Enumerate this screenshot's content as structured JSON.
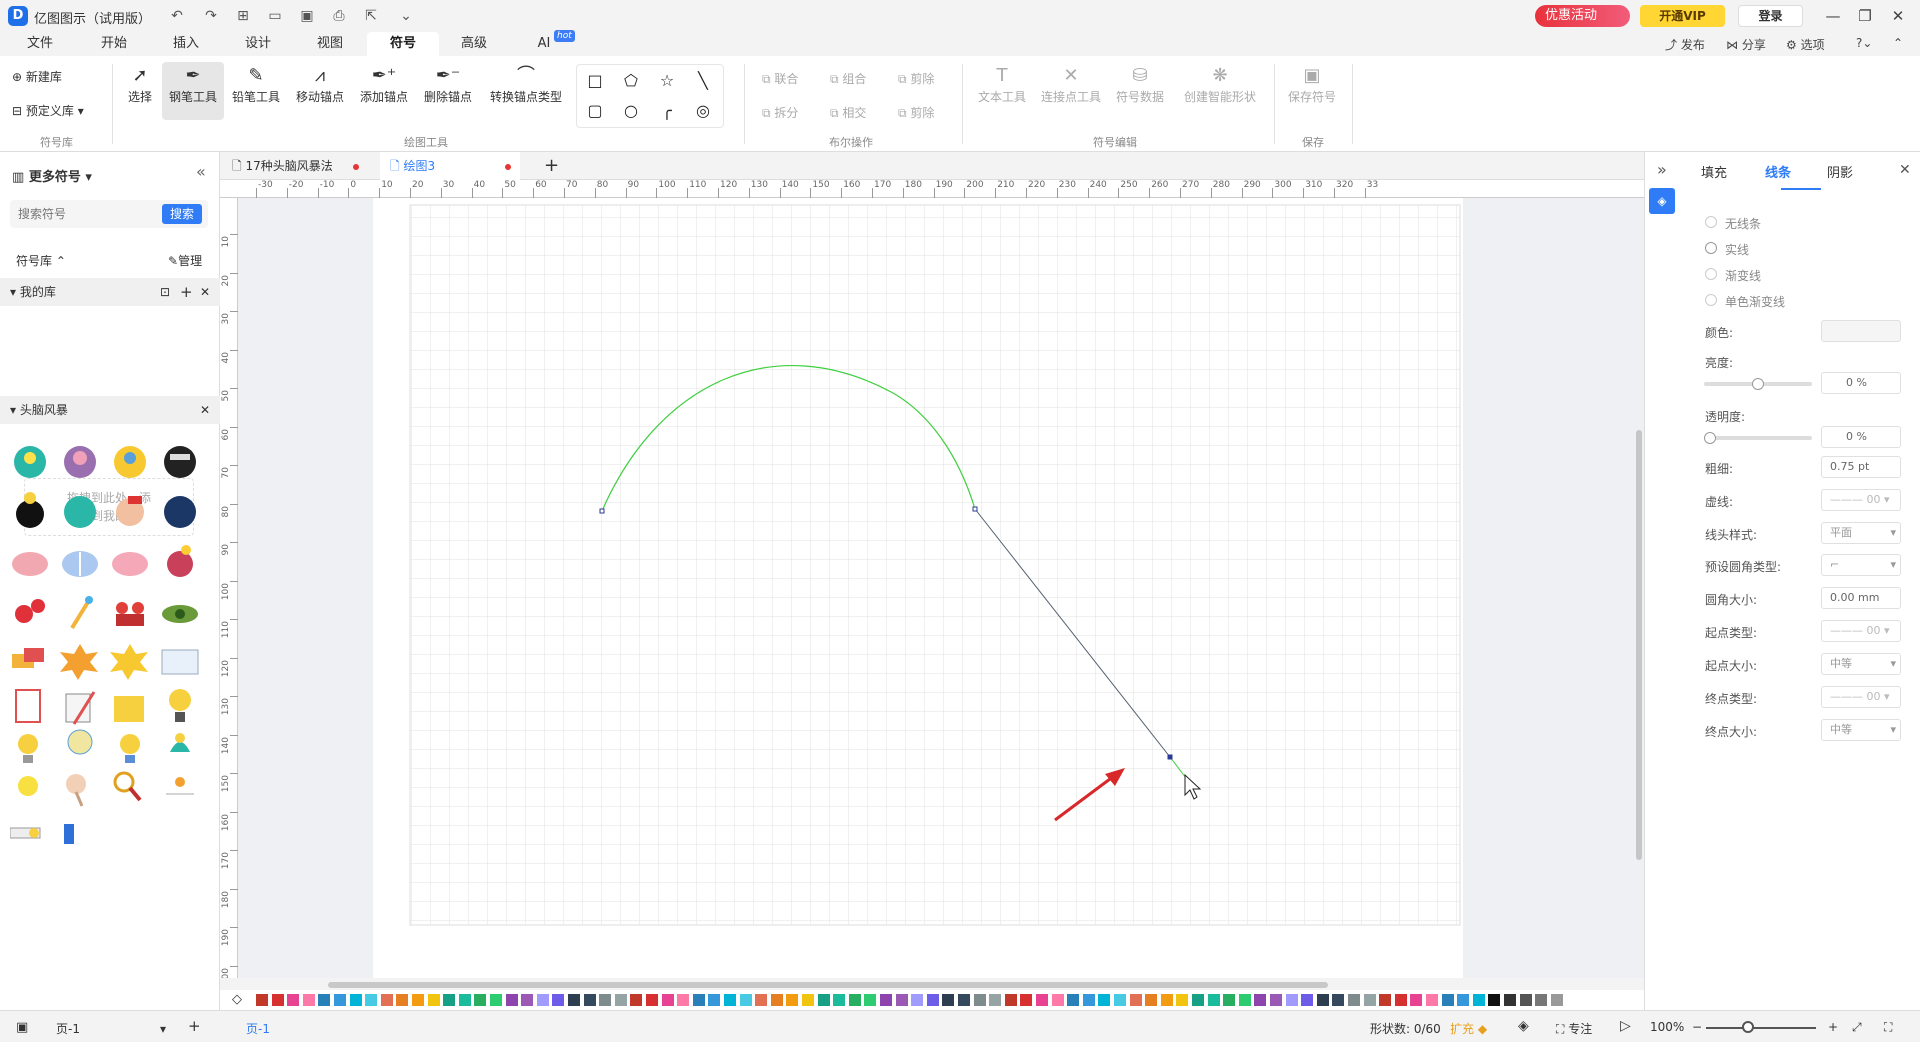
{
  "app": {
    "logo": "D",
    "title": "亿图图示（试用版）",
    "promo": "优惠活动",
    "vip": "开通VIP",
    "login": "登录"
  },
  "quick_access": [
    "undo-icon",
    "redo-icon",
    "new-icon",
    "open-icon",
    "save-icon",
    "print-icon",
    "export-icon",
    "more-icon"
  ],
  "menu": {
    "items": [
      "文件",
      "开始",
      "插入",
      "设计",
      "视图",
      "符号",
      "高级",
      "AI"
    ],
    "active": "符号",
    "hot_badge": "hot",
    "right": {
      "publish": "发布",
      "share": "分享",
      "options": "选项"
    }
  },
  "ribbon": {
    "library": {
      "new_lib": "新建库",
      "predefined": "预定义库",
      "group": "符号库"
    },
    "draw_tools": {
      "select": "选择",
      "pen": "钢笔工具",
      "pencil": "铅笔工具",
      "move_anchor": "移动锚点",
      "add_anchor": "添加锚点",
      "delete_anchor": "删除锚点",
      "convert_anchor": "转换锚点类型",
      "group": "绘图工具"
    },
    "boolean": {
      "union": "联合",
      "combine": "组合",
      "subtract": "剪除",
      "split": "拆分",
      "intersect": "相交",
      "cut": "剪除",
      "group": "布尔操作"
    },
    "symbol_edit": {
      "text_tool": "文本工具",
      "connect_tool": "连接点工具",
      "symbol_data": "符号数据",
      "smart_shape": "创建智能形状",
      "group": "符号编辑"
    },
    "save": {
      "save_symbol": "保存符号",
      "group": "保存"
    }
  },
  "left_panel": {
    "more_symbols": "更多符号",
    "search_placeholder": "搜索符号",
    "search_btn": "搜索",
    "library_label": "符号库",
    "manage": "管理",
    "my_library": "我的库",
    "drop_hint_1": "拖拽到此处，添",
    "drop_hint_2": "加到我的库",
    "brainstorm": "头脑风暴"
  },
  "tabs": [
    {
      "label": "17种头脑风暴法"
    },
    {
      "label": "绘图3"
    }
  ],
  "ruler": {
    "h_labels": [
      "-30",
      "-20",
      "-10",
      "0",
      "10",
      "20",
      "30",
      "40",
      "50",
      "60",
      "70",
      "80",
      "90",
      "100",
      "110",
      "120",
      "130",
      "140",
      "150",
      "160",
      "170",
      "180",
      "190",
      "200",
      "210",
      "220",
      "230",
      "240",
      "250",
      "260",
      "270",
      "280",
      "290",
      "300",
      "310",
      "320",
      "33"
    ],
    "v_labels": [
      "10",
      "20",
      "30",
      "40",
      "50",
      "60",
      "70",
      "80",
      "90",
      "100",
      "110",
      "120",
      "130",
      "140",
      "150",
      "160",
      "170",
      "180",
      "190",
      "200"
    ]
  },
  "right_panel": {
    "tabs": [
      "填充",
      "线条",
      "阴影"
    ],
    "active_tab": "线条",
    "line_options": [
      "无线条",
      "实线",
      "渐变线",
      "单色渐变线"
    ],
    "labels": {
      "color": "颜色:",
      "brightness": "亮度:",
      "transparency": "透明度:",
      "weight": "粗细:",
      "dash": "虚线:",
      "cap": "线头样式:",
      "corner_type": "预设圆角类型:",
      "corner_size": "圆角大小:",
      "start_type": "起点类型:",
      "start_size": "起点大小:",
      "end_type": "终点类型:",
      "end_size": "终点大小:"
    },
    "values": {
      "brightness": "0 %",
      "brightness_level": 0.5,
      "transparency": "0 %",
      "transparency_level": 0,
      "weight": "0.75 pt",
      "dash": "00",
      "cap": "平面",
      "corner_size": "0.00 mm",
      "start_type": "00",
      "start_size": "中等",
      "end_type": "00",
      "end_size": "中等"
    }
  },
  "status": {
    "page_select": "页-1",
    "page_tab": "页-1",
    "shape_count": "形状数: 0/60",
    "expand": "扩充",
    "focus": "专注",
    "zoom": "100%"
  },
  "colors": {
    "accent": "#2f7cf6",
    "curve": "#3fcf3f",
    "line": "#556070"
  }
}
